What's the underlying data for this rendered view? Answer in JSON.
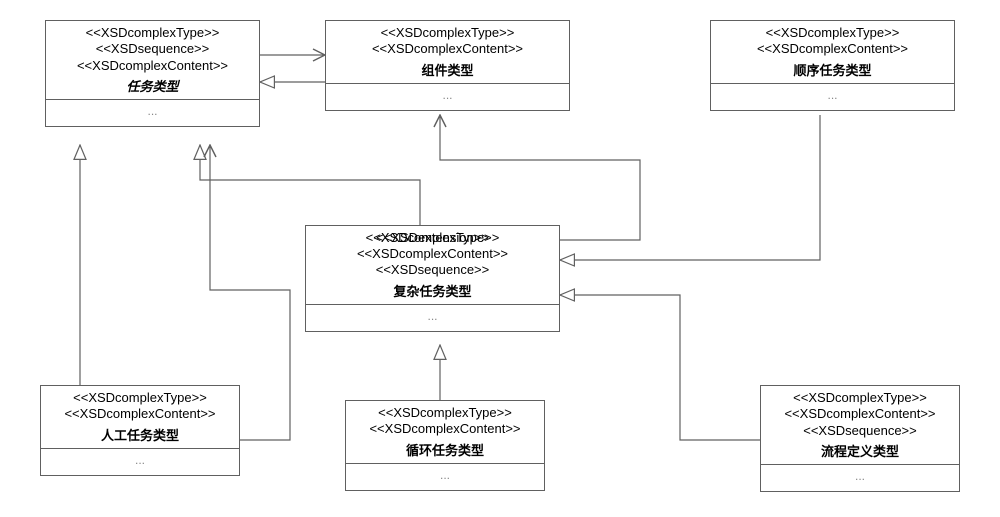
{
  "nodes": {
    "task": {
      "stereotypes": [
        "<<XSDcomplexType>>",
        "<<XSDsequence>>",
        "<<XSDcomplexContent>>"
      ],
      "title": "任务类型",
      "body": "..."
    },
    "component": {
      "stereotypes": [
        "<<XSDcomplexType>>",
        "<<XSDcomplexContent>>"
      ],
      "title": "组件类型",
      "body": "..."
    },
    "sequential": {
      "stereotypes": [
        "<<XSDcomplexType>>",
        "<<XSDcomplexContent>>"
      ],
      "title": "顺序任务类型",
      "body": "..."
    },
    "complex": {
      "stereo_overlay_a": "<<XSDextension>>",
      "stereo_overlay_b": "<<XSDcomplexType>>",
      "stereotypes": [
        "<<XSDcomplexContent>>",
        "<<XSDsequence>>"
      ],
      "title": "复杂任务类型",
      "body": "..."
    },
    "manual": {
      "stereotypes": [
        "<<XSDcomplexType>>",
        "<<XSDcomplexContent>>"
      ],
      "title": "人工任务类型",
      "body": "..."
    },
    "loop": {
      "stereotypes": [
        "<<XSDcomplexType>>",
        "<<XSDcomplexContent>>"
      ],
      "title": "循环任务类型",
      "body": "..."
    },
    "process": {
      "stereotypes": [
        "<<XSDcomplexType>>",
        "<<XSDcomplexContent>>",
        "<<XSDsequence>>"
      ],
      "title": "流程定义类型",
      "body": "..."
    }
  }
}
